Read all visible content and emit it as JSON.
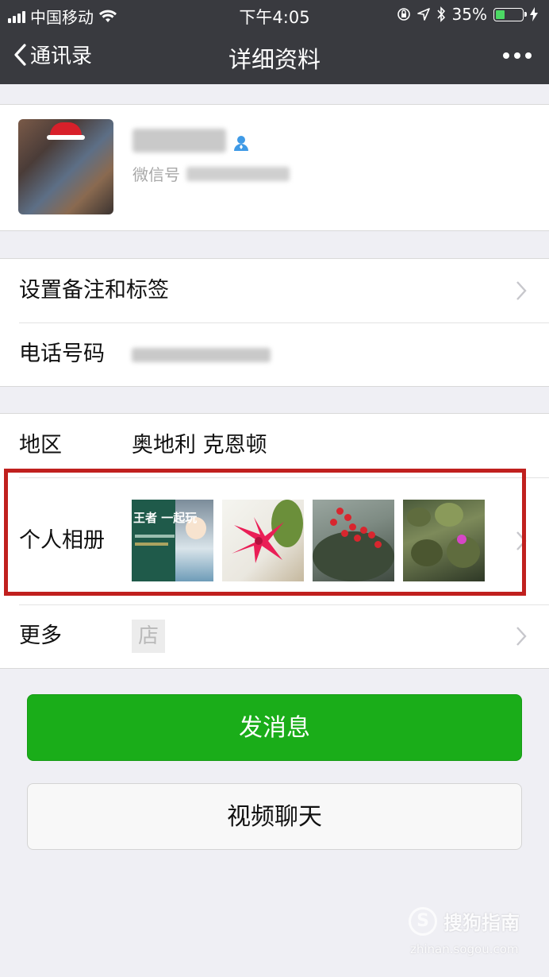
{
  "status_bar": {
    "carrier": "中国移动",
    "time": "下午4:05",
    "battery_percent": "35%",
    "battery_level": 0.35,
    "icons": [
      "signal-icon",
      "wifi-icon",
      "orientation-lock-icon",
      "location-icon",
      "bluetooth-icon",
      "battery-icon",
      "charging-icon"
    ]
  },
  "nav": {
    "back_label": "通讯录",
    "title": "详细资料",
    "more_icon": "more-dots-icon"
  },
  "profile": {
    "name": "",
    "wechat_id_label": "微信号",
    "wechat_id": "",
    "verify_icon": "contact-verified-icon"
  },
  "rows": {
    "remark": {
      "label": "设置备注和标签"
    },
    "phone": {
      "label": "电话号码",
      "value": ""
    },
    "region": {
      "label": "地区",
      "value": "奥地利 克恩顿"
    },
    "album": {
      "label": "个人相册",
      "thumbnail_text": "王者 一起玩"
    },
    "more": {
      "label": "更多",
      "store_icon_text": "店"
    }
  },
  "buttons": {
    "send_message": "发消息",
    "video_chat": "视频聊天"
  },
  "watermark": {
    "logo_text": "S",
    "brand": "搜狗指南",
    "url": "zhinan.sogou.com"
  },
  "colors": {
    "nav_bg": "#393a3f",
    "primary_green": "#1aad19",
    "highlight_red": "#c0201e",
    "page_bg": "#efeff4"
  }
}
